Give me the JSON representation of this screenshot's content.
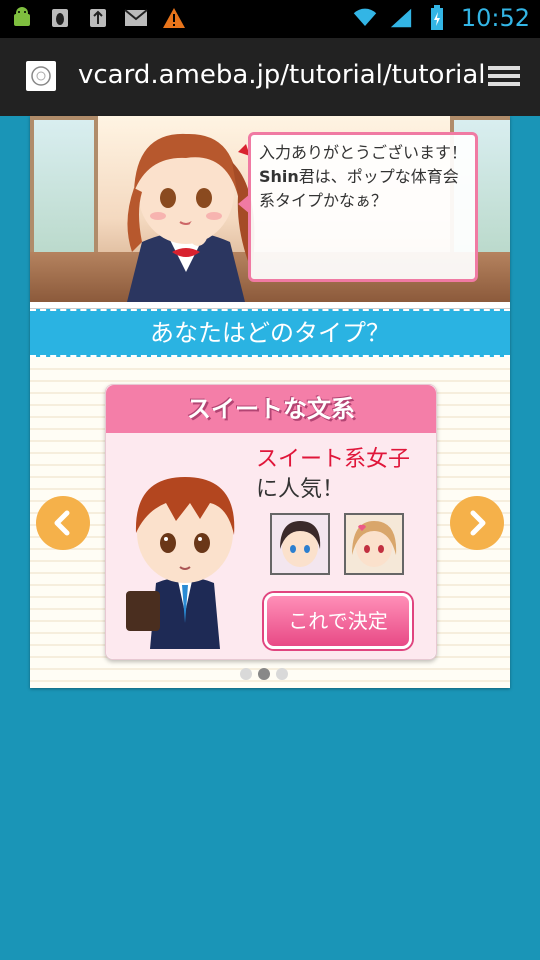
{
  "status_bar": {
    "time": "10:52",
    "icons": [
      "android-debug-icon",
      "bug-icon",
      "usb-icon",
      "gmail-icon",
      "warning-icon",
      "wifi-icon",
      "signal-icon",
      "battery-charging-icon"
    ]
  },
  "browser": {
    "url": "vcard.ameba.jp/tutorial/tutorial"
  },
  "scene": {
    "speech_line1": "入力ありがとうございます！",
    "speech_name": "Shin",
    "speech_line2": "君は、ポップな体育会系タイプかなぁ？"
  },
  "section_title": "あなたはどのタイプ？",
  "card": {
    "title": "スイートな文系",
    "popular_highlight": "スイート系女子",
    "popular_rest": "に人気！",
    "decide_button": "これで決定"
  },
  "carousel": {
    "page_count": 3,
    "active_index": 1
  },
  "colors": {
    "background": "#1a95b7",
    "title_bar": "#2ab3e2",
    "card_header": "#f47ea8",
    "arrow": "#f5b14a",
    "accent_text": "#e0163a"
  }
}
